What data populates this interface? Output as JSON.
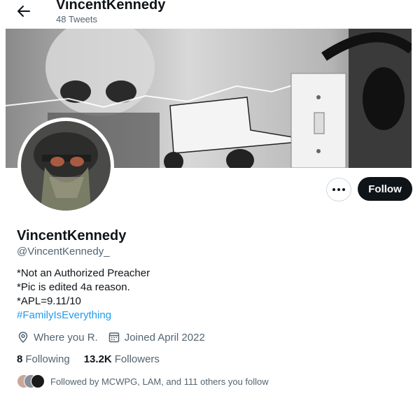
{
  "header": {
    "title": "VincentKennedy",
    "tweet_count": "48 Tweets"
  },
  "profile": {
    "display_name": "VincentKennedy",
    "handle": "@VincentKennedy_",
    "bio_lines": [
      "*Not an Authorized Preacher",
      "*Pic is edited 4a reason.",
      "*APL=9.11/10"
    ],
    "hashtag": "#FamilyIsEverything",
    "location": "Where you R.",
    "joined": "Joined April 2022",
    "following_count": "8",
    "following_label": "Following",
    "followers_count": "13.2K",
    "followers_label": "Followers",
    "followed_by": "Followed by MCWPG, LAM, and 111 others you follow"
  },
  "actions": {
    "follow_label": "Follow"
  },
  "colors": {
    "text": "#0f1419",
    "secondary": "#536471",
    "link": "#1d9bf0",
    "follow_bg": "#0f1419"
  }
}
